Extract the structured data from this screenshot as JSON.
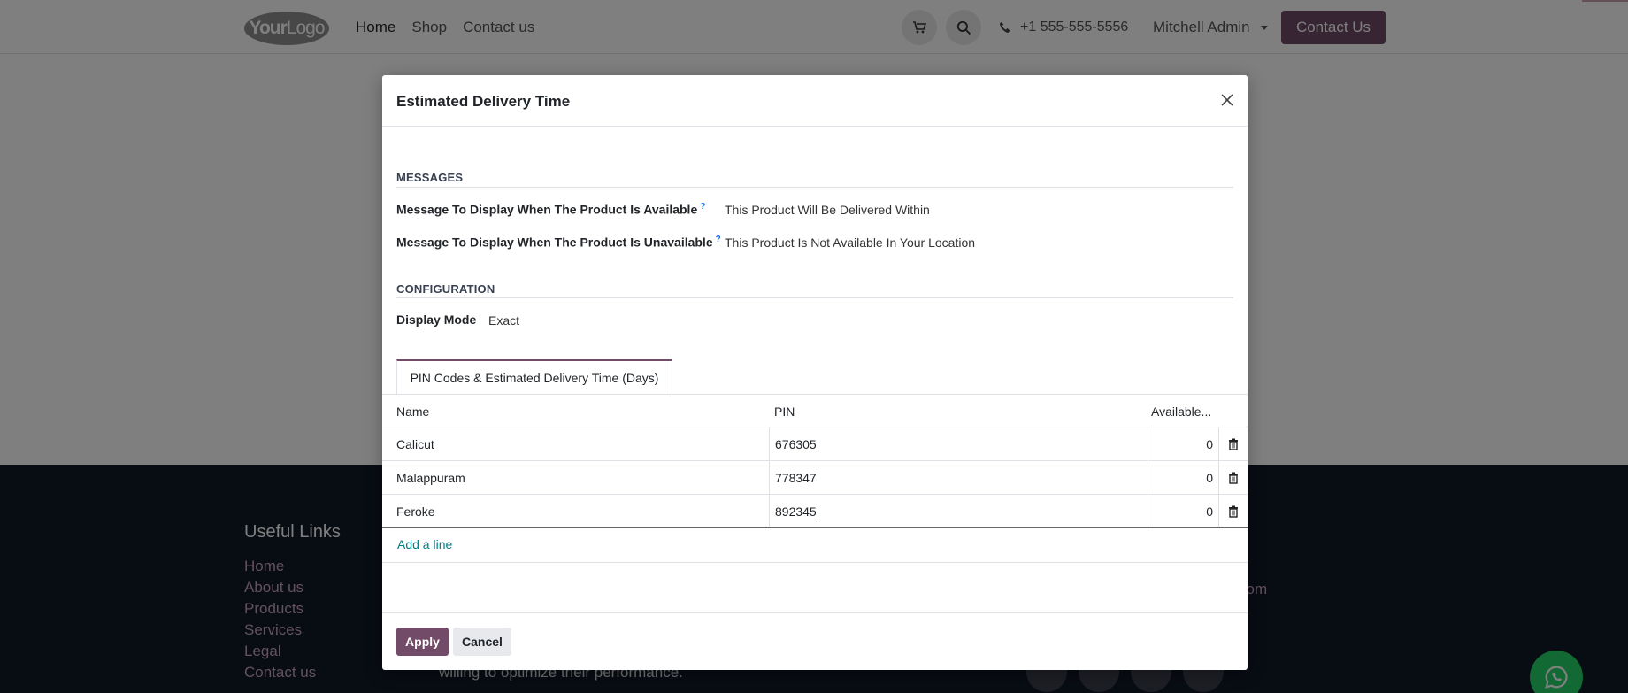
{
  "site": {
    "logo_bold": "Your",
    "logo_thin": "Logo",
    "nav": [
      {
        "label": "Home"
      },
      {
        "label": "Shop"
      },
      {
        "label": "Contact us"
      }
    ],
    "phone": "+1 555-555-5556",
    "user": "Mitchell Admin",
    "contact_button": "Contact Us",
    "footer": {
      "title": "Useful Links",
      "links": [
        "Home",
        "About us",
        "Products",
        "Services",
        "Legal",
        "Contact us"
      ],
      "text_partial": "willing to optimize their performance.",
      "email_partial": "com"
    }
  },
  "modal": {
    "title": "Estimated Delivery Time",
    "messages": {
      "section": "MESSAGES",
      "available_label": "Message To Display When The Product Is Available",
      "available_value": "This Product Will Be Delivered Within",
      "unavailable_label": "Message To Display When The Product Is Unavailable",
      "unavailable_value": "This Product Is Not Available In Your Location",
      "help_mark": "?"
    },
    "configuration": {
      "section": "CONFIGURATION",
      "display_mode_label": "Display Mode",
      "display_mode_value": "Exact"
    },
    "tab_label": "PIN Codes & Estimated Delivery Time (Days)",
    "table": {
      "columns": [
        "Name",
        "PIN",
        "Available..."
      ],
      "rows": [
        {
          "name": "Calicut",
          "pin": "676305",
          "available": "0"
        },
        {
          "name": "Malappuram",
          "pin": "778347",
          "available": "0"
        },
        {
          "name": "Feroke",
          "pin": "892345",
          "available": "0"
        }
      ],
      "add_line": "Add a line"
    },
    "apply": "Apply",
    "cancel": "Cancel"
  }
}
